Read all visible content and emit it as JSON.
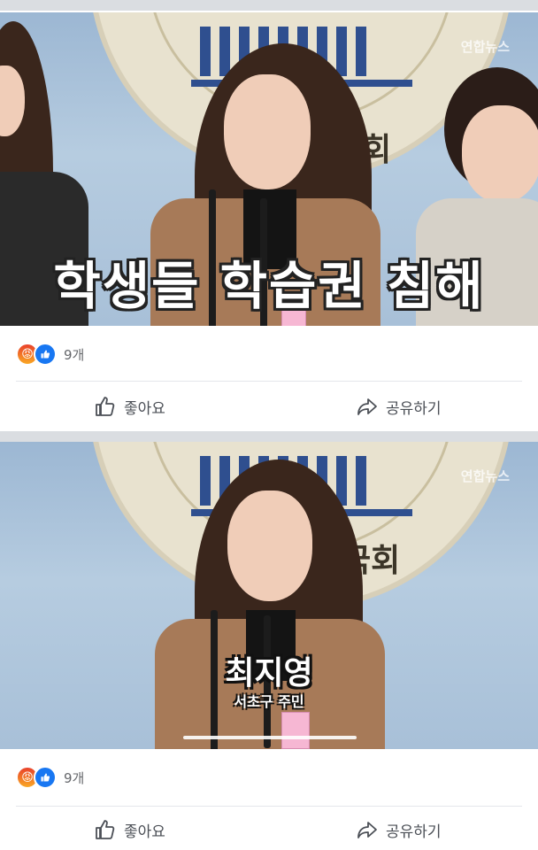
{
  "posts": [
    {
      "watermark": "연합뉴스",
      "caption": "학생들 학습권 침해",
      "seal_text": "국회",
      "reaction_count": "9개",
      "like_label": "좋아요",
      "share_label": "공유하기"
    },
    {
      "watermark": "연합뉴스",
      "caption_name": "최지영",
      "caption_sub": "서초구 주민",
      "seal_text": "국회",
      "reaction_count": "9개",
      "like_label": "좋아요",
      "share_label": "공유하기"
    }
  ],
  "icons": {
    "angry": "angry-reaction-icon",
    "like": "like-reaction-icon",
    "thumb": "thumbs-up-icon",
    "share": "share-arrow-icon"
  }
}
